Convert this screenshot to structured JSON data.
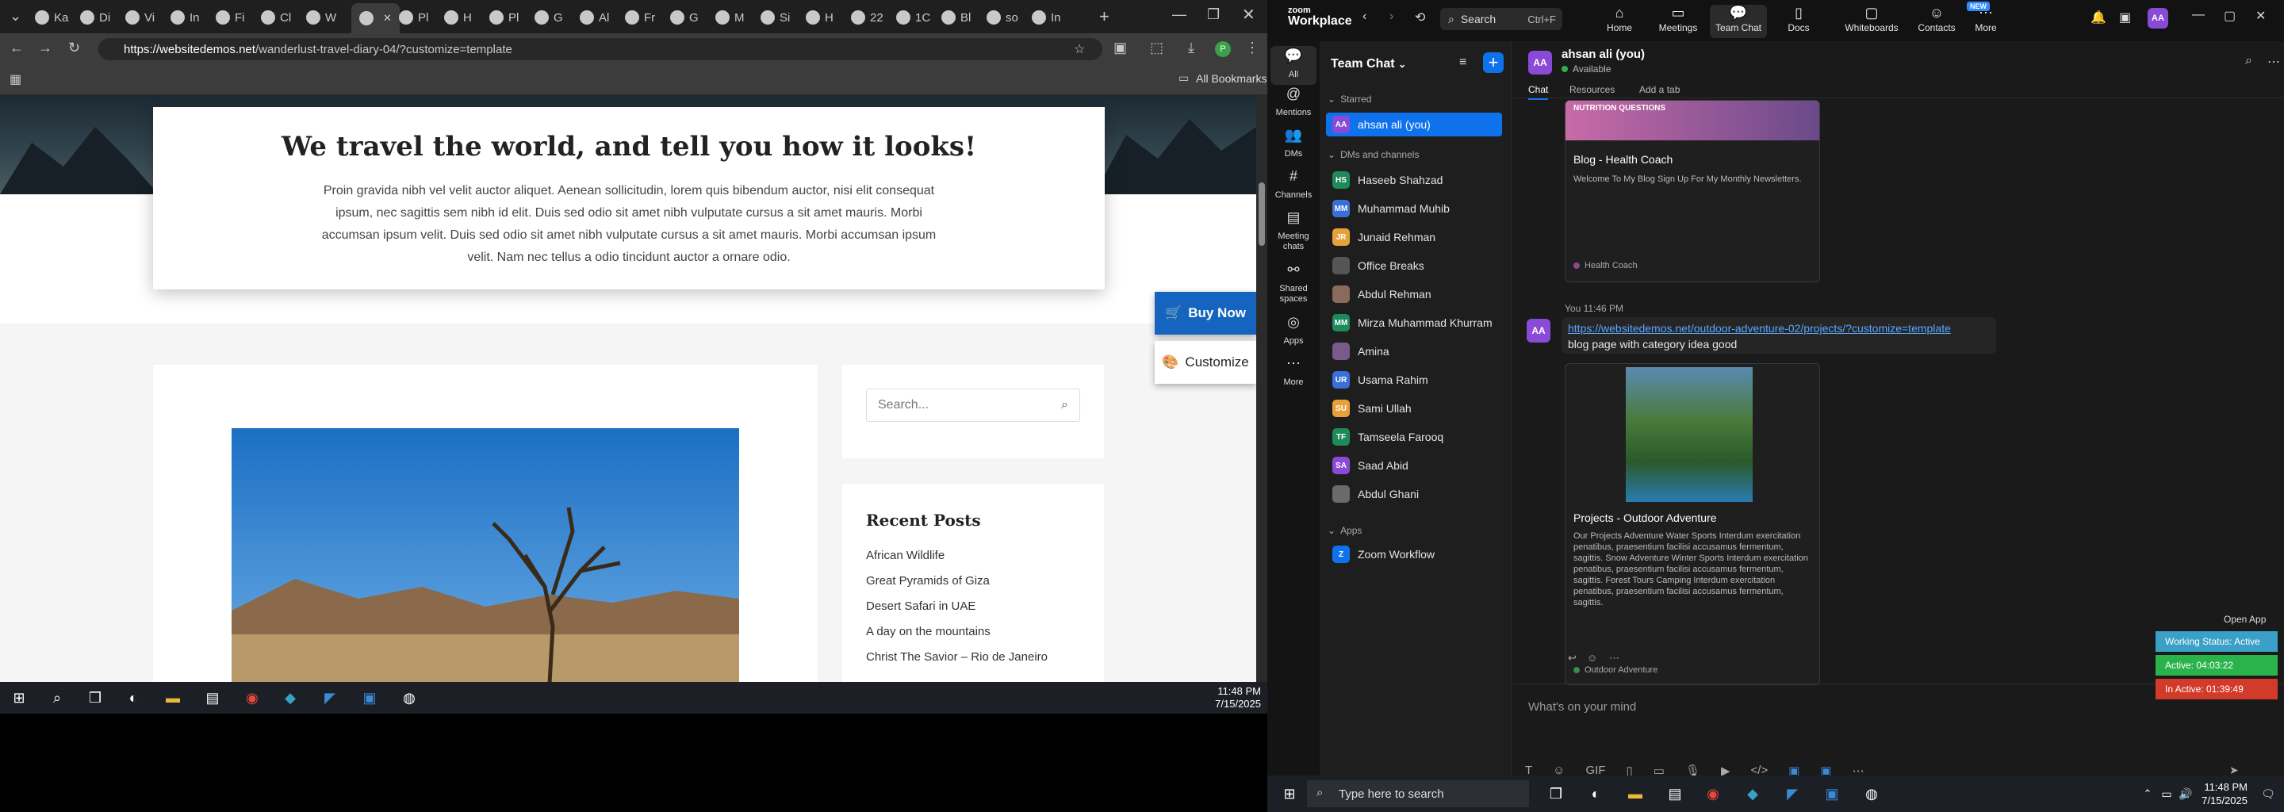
{
  "browser": {
    "tabs": [
      "Ka",
      "Di",
      "Vi",
      "In",
      "Fi",
      "Cl",
      "W",
      "",
      "Pl",
      "H",
      "Pl",
      "G",
      "Al",
      "Fr",
      "G",
      "M",
      "Si",
      "H",
      "22",
      "1C",
      "Bl",
      "so",
      "In"
    ],
    "url_host": "https://websitedemos.net",
    "url_path": "/wanderlust-travel-diary-04/?customize=template",
    "bookmarks_label": "All Bookmarks"
  },
  "website": {
    "hero_title": "We travel the world, and tell you how it looks!",
    "hero_text": "Proin gravida nibh vel velit auctor aliquet. Aenean sollicitudin, lorem quis bibendum auctor, nisi elit consequat ipsum, nec sagittis sem nibh id elit. Duis sed odio sit amet nibh vulputate cursus a sit amet mauris. Morbi accumsan ipsum velit. Duis sed odio sit amet nibh vulputate cursus a sit amet mauris. Morbi accumsan ipsum velit. Nam nec tellus a odio tincidunt auctor a ornare odio.",
    "buy_now": "Buy Now",
    "customize": "Customize",
    "search_placeholder": "Search...",
    "recent_posts_title": "Recent Posts",
    "recent_posts": [
      "African Wildlife",
      "Great Pyramids of Giza",
      "Desert Safari in UAE",
      "A day on the mountains",
      "Christ The Savior – Rio de Janeiro"
    ]
  },
  "left_taskbar": {
    "time": "11:48 PM",
    "date": "7/15/2025"
  },
  "zoom": {
    "logo_line1": "zoom",
    "logo_line2": "Workplace",
    "search_label": "Search",
    "search_shortcut": "Ctrl+F",
    "nav": [
      "Home",
      "Meetings",
      "Team Chat",
      "Docs",
      "Whiteboards",
      "Contacts",
      "More"
    ],
    "new_badge": "NEW",
    "rail": [
      "All",
      "Mentions",
      "DMs",
      "Channels",
      "Meeting chats",
      "Shared spaces",
      "Apps",
      "More"
    ],
    "list_title": "Team Chat",
    "sections": {
      "starred": "Starred",
      "dms": "DMs and channels",
      "apps": "Apps"
    },
    "starred_item": {
      "initials": "AA",
      "name": "ahsan ali (you)"
    },
    "dms": [
      {
        "initials": "HS",
        "name": "Haseeb Shahzad",
        "color": "#1e8a5a"
      },
      {
        "initials": "MM",
        "name": "Muhammad Muhib",
        "color": "#3a6fd8"
      },
      {
        "initials": "JR",
        "name": "Junaid Rehman",
        "color": "#e8a13a"
      },
      {
        "initials": "",
        "name": "Office Breaks",
        "color": "#555555"
      },
      {
        "initials": "",
        "name": "Abdul Rehman",
        "color": "#8a6a5a"
      },
      {
        "initials": "MM",
        "name": "Mirza Muhammad Khurram",
        "color": "#1e8a5a"
      },
      {
        "initials": "",
        "name": "Amina",
        "color": "#7a5a8a"
      },
      {
        "initials": "UR",
        "name": "Usama Rahim",
        "color": "#3a6fd8"
      },
      {
        "initials": "SU",
        "name": "Sami Ullah",
        "color": "#e8a13a"
      },
      {
        "initials": "TF",
        "name": "Tamseela Farooq",
        "color": "#1e8a5a"
      },
      {
        "initials": "SA",
        "name": "Saad Abid",
        "color": "#8a4ad8"
      },
      {
        "initials": "",
        "name": "Abdul Ghani",
        "color": "#6a6a6a"
      }
    ],
    "app_item": "Zoom Workflow",
    "chat_header_name": "ahsan ali (you)",
    "chat_header_status": "Available",
    "chat_tabs": [
      "Chat",
      "Resources",
      "Add a tab"
    ],
    "card1": {
      "title": "Blog - Health Coach",
      "desc": "Welcome To My Blog Sign Up For My Monthly Newsletters.",
      "source": "Health Coach",
      "banner": "NUTRITION QUESTIONS"
    },
    "msg_meta": "You 11:46 PM",
    "msg_link": "https://websitedemos.net/outdoor-adventure-02/projects/?customize=template",
    "msg_text": "blog page with category idea good",
    "card2": {
      "title": "Projects - Outdoor Adventure",
      "desc": "Our Projects Adventure Water Sports Interdum exercitation penatibus, praesentium facilisi accusamus fermentum, sagittis. Snow Adventure Winter Sports Interdum exercitation penatibus, praesentium facilisi accusamus fermentum, sagittis. Forest Tours Camping Interdum exercitation penatibus, praesentium facilisi accusamus fermentum, sagittis.",
      "source": "Outdoor Adventure"
    },
    "composer_placeholder": "What's on your mind",
    "open_app": "Open App",
    "working_status": [
      {
        "label": "Working Status: Active",
        "color": "#3aa0c8"
      },
      {
        "label": "Active: 04:03:22",
        "color": "#2bb34b"
      },
      {
        "label": "In Active: 01:39:49",
        "color": "#d23a2a"
      }
    ]
  },
  "right_taskbar": {
    "search_placeholder": "Type here to search",
    "time": "11:48 PM",
    "date": "7/15/2025"
  }
}
